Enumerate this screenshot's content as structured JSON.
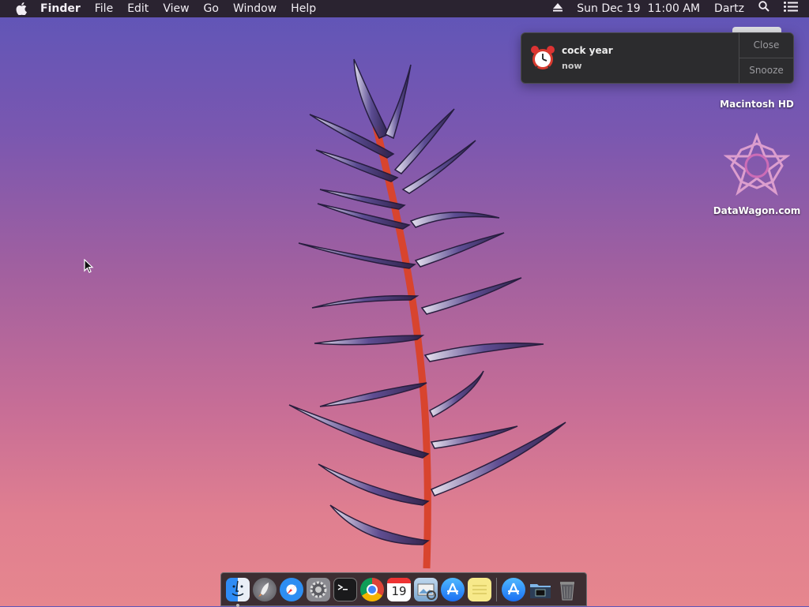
{
  "menubar": {
    "app_name": "Finder",
    "menus": [
      "File",
      "Edit",
      "View",
      "Go",
      "Window",
      "Help"
    ],
    "datetime": "Sun Dec 19  11:00 AM",
    "user": "Dartz"
  },
  "notification": {
    "title": "cock year",
    "subtitle": "now",
    "close_label": "Close",
    "snooze_label": "Snooze"
  },
  "desktop": {
    "icons": [
      {
        "label": "Macintosh HD"
      },
      {
        "label": "DataWagon.com"
      }
    ]
  },
  "dock": {
    "items": [
      "finder",
      "launchpad",
      "safari",
      "system-preferences",
      "terminal",
      "chrome",
      "calendar",
      "preview",
      "app-store",
      "notes",
      "app-store",
      "folder",
      "trash"
    ],
    "calendar_day": "19"
  }
}
